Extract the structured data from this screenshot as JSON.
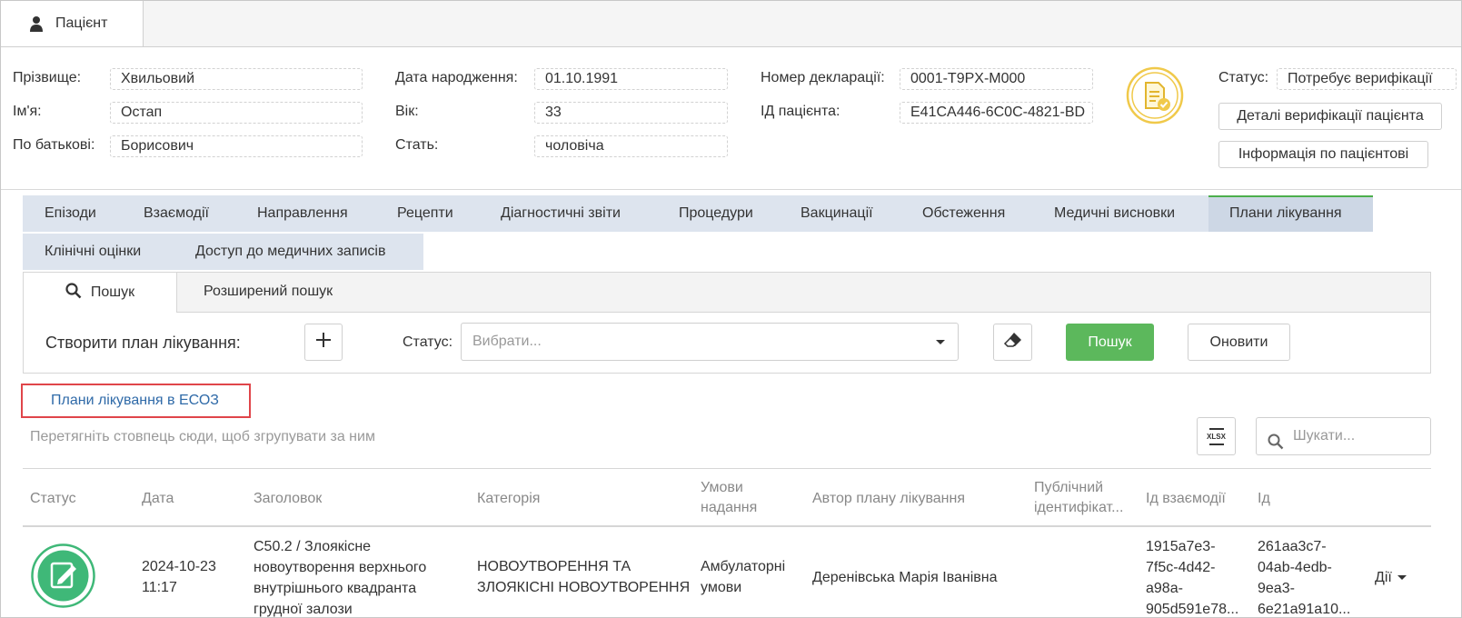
{
  "top_tab": {
    "label": "Пацієнт",
    "icon": "person-icon"
  },
  "patient": {
    "surname_label": "Прізвище:",
    "surname": "Хвильовий",
    "name_label": "Ім'я:",
    "name": "Остап",
    "patronymic_label": "По батькові:",
    "patronymic": "Борисович",
    "dob_label": "Дата народження:",
    "dob": "01.10.1991",
    "age_label": "Вік:",
    "age": "33",
    "sex_label": "Стать:",
    "sex": "чоловіча",
    "declaration_label": "Номер декларації:",
    "declaration": "0001-T9PX-M000",
    "id_label": "ІД пацієнта:",
    "id": "E41CA446-6C0C-4821-BD",
    "status_label": "Статус:",
    "status": "Потребує верифікації",
    "verify_details_button": "Деталі верифікації пацієнта",
    "patient_info_button": "Інформація по пацієнтові"
  },
  "tabs_row1": [
    "Епізоди",
    "Взаємодії",
    "Направлення",
    "Рецепти",
    "Діагностичні звіти",
    "Процедури",
    "Вакцинації",
    "Обстеження",
    "Медичні висновки",
    "Плани лікування"
  ],
  "tabs_row2": [
    "Клінічні оцінки",
    "Доступ до медичних записів"
  ],
  "active_tab": "Плани лікування",
  "search": {
    "tab_simple": "Пошук",
    "tab_extended": "Розширений пошук",
    "create_label": "Створити план лікування:",
    "status_label": "Статус:",
    "status_placeholder": "Вибрати...",
    "search_button": "Пошук",
    "refresh_button": "Оновити"
  },
  "ecoz_link": "Плани лікування в ЕСОЗ",
  "group_hint": "Перетягніть стовпець сюди, щоб згрупувати за ним",
  "grid_search_placeholder": "Шукати...",
  "xlsx_label": "XLSX",
  "table": {
    "headers": {
      "status": "Статус",
      "date": "Дата",
      "title": "Заголовок",
      "category": "Категорія",
      "conditions": [
        "Умови",
        "надання"
      ],
      "author": "Автор плану лікування",
      "public_id": [
        "Публічний",
        "ідентифікат..."
      ],
      "interaction_id": "Ід взаємодії",
      "id": "Ід"
    },
    "rows": [
      {
        "date": [
          "2024-10-23",
          "11:17"
        ],
        "title": [
          "C50.2 / Злоякісне",
          "новоутворення верхнього",
          "внутрішнього квадранта",
          "грудної залози"
        ],
        "category": [
          "НОВОУТВОРЕННЯ ТА",
          "ЗЛОЯКІСНІ НОВОУТВОРЕННЯ"
        ],
        "conditions": [
          "Амбулаторні",
          "умови"
        ],
        "author": "Деренівська Марія Іванівна",
        "interaction_id": [
          "1915a7e3-",
          "7f5c-4d42-",
          "a98a-",
          "905d591e78..."
        ],
        "id": [
          "261aa3c7-",
          "04ab-4edb-",
          "9ea3-",
          "6e21a91a10..."
        ],
        "actions": "Дії"
      }
    ]
  },
  "colors": {
    "accent_green": "#5cb85c",
    "tab_bg": "#dde4ee",
    "link_blue": "#2f6aa8",
    "highlight_red": "#e0454a",
    "gold": "#f0c94a"
  }
}
